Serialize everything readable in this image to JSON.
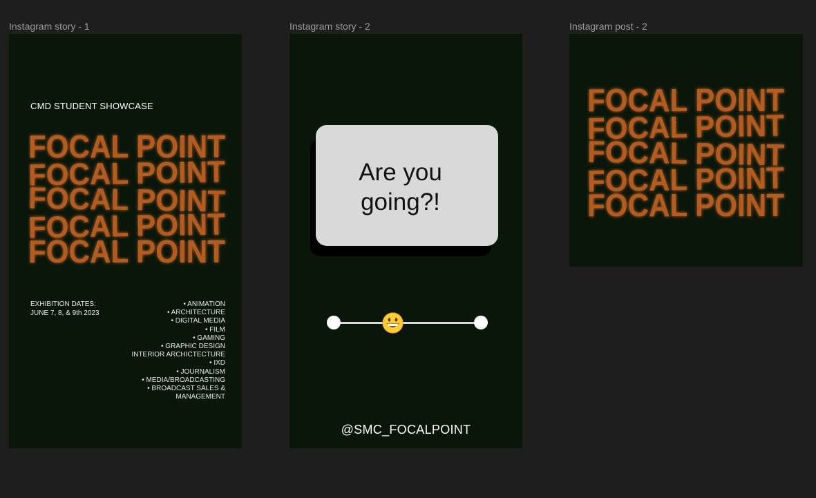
{
  "frames": [
    {
      "label": "Instagram story - 1"
    },
    {
      "label": "Instagram story - 2"
    },
    {
      "label": "Instagram post - 2"
    }
  ],
  "story1": {
    "kicker": "CMD STUDENT SHOWCASE",
    "wordmark": "FOCAL POINT",
    "dates_label": "EXHIBITION DATES:",
    "dates_value": "JUNE 7, 8, & 9th 2023",
    "disciplines": [
      "•  ANIMATION",
      "•  ARCHITECTURE",
      "•  DIGITAL MEDIA",
      "•  FILM",
      "•  GAMING",
      "•  GRAPHIC  DESIGN",
      "INTERIOR ARCHICTECTURE",
      "•  IXD",
      "•  JOURNALISM",
      "•  MEDIA/BROADCASTING",
      "•  BROADCAST SALES &\nMANAGEMENT"
    ]
  },
  "story2": {
    "question": "Are you\ngoing?!",
    "slider_value": 0.4,
    "emoji": "grinning-face-emoji",
    "handle": "@SMC_FOCALPOINT"
  },
  "post2": {
    "wordmark": "FOCAL POINT"
  },
  "colors": {
    "canvas": "#1e1e1e",
    "frame_bg": "#0a160a",
    "wordmark": "#b35c22"
  }
}
